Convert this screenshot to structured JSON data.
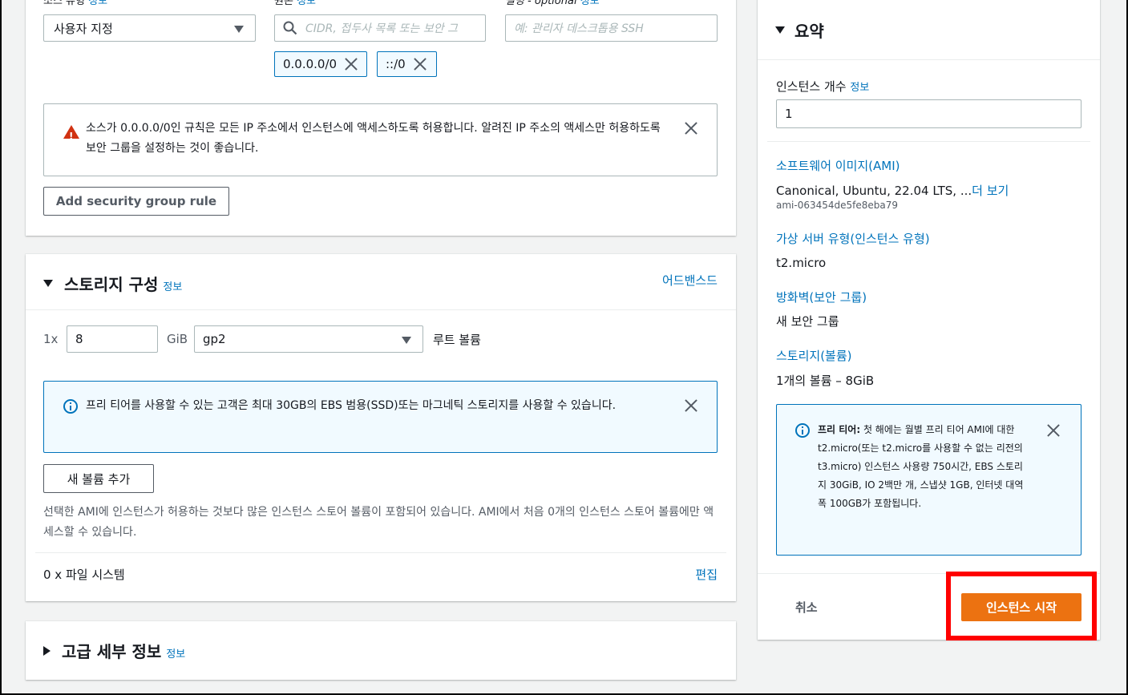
{
  "colors": {
    "link": "#0073bb",
    "primary": "#ec7211",
    "warning": "#d13212",
    "highlight": "#ff0000"
  },
  "inbound_rule": {
    "source_type_label": "소스 유형",
    "source_type_info": "정보",
    "source_type_value": "사용자 지정",
    "source_label": "원본",
    "source_info": "정보",
    "source_placeholder": "CIDR, 접두사 목록 또는 보안 그",
    "description_label": "설명 - optional",
    "description_info": "정보",
    "description_placeholder": "예: 관리자 데스크톱용 SSH",
    "tokens": [
      "0.0.0.0/0",
      "::/0"
    ],
    "warning_text": "소스가 0.0.0.0/0인 규칙은 모든 IP 주소에서 인스턴스에 액세스하도록 허용합니다. 알려진 IP 주소의 액세스만 허용하도록 보안 그룹을 설정하는 것이 좋습니다.",
    "add_rule_button": "Add security group rule"
  },
  "storage": {
    "title": "스토리지 구성",
    "info": "정보",
    "advanced_link": "어드밴스드",
    "count_prefix": "1x",
    "size_value": "8",
    "size_unit": "GiB",
    "volume_type": "gp2",
    "root_label": "루트 볼륨",
    "free_tier_text": "프리 티어를 사용할 수 있는 고객은 최대 30GB의 EBS 범용(SSD)또는 마그네틱 스토리지를 사용할 수 있습니다.",
    "add_volume_button": "새 볼륨 추가",
    "instance_store_note": "선택한 AMI에 인스턴스가 허용하는 것보다 많은 인스턴스 스토어 볼륨이 포함되어 있습니다. AMI에서 처음 0개의 인스턴스 스토어 볼륨에만 액세스할 수 있습니다.",
    "file_systems_label": "0 x 파일 시스템",
    "edit_link": "편집"
  },
  "advanced_details": {
    "title": "고급 세부 정보",
    "info": "정보"
  },
  "summary": {
    "title": "요약",
    "instance_count_label": "인스턴스 개수",
    "instance_count_info": "정보",
    "instance_count_value": "1",
    "ami_label": "소프트웨어 이미지(AMI)",
    "ami_value": "Canonical, Ubuntu, 22.04 LTS, ...",
    "ami_more_link": "더 보기",
    "ami_id": "ami-063454de5fe8eba79",
    "instance_type_label": "가상 서버 유형(인스턴스 유형)",
    "instance_type_value": "t2.micro",
    "firewall_label": "방화벽(보안 그룹)",
    "firewall_value": "새 보안 그룹",
    "storage_label": "스토리지(볼륨)",
    "storage_value": "1개의 볼륨 – 8GiB",
    "free_tier_bold": "프리 티어:",
    "free_tier_text": " 첫 해에는 월별 프리 티어 AMI에 대한 t2.micro(또는 t2.micro를 사용할 수 없는 리전의 t3.micro) 인스턴스 사용량 750시간, EBS 스토리지 30GiB, IO 2백만 개, 스냅샷 1GB, 인터넷 대역폭 100GB가 포함됩니다.",
    "cancel_button": "취소",
    "launch_button": "인스턴스 시작"
  }
}
